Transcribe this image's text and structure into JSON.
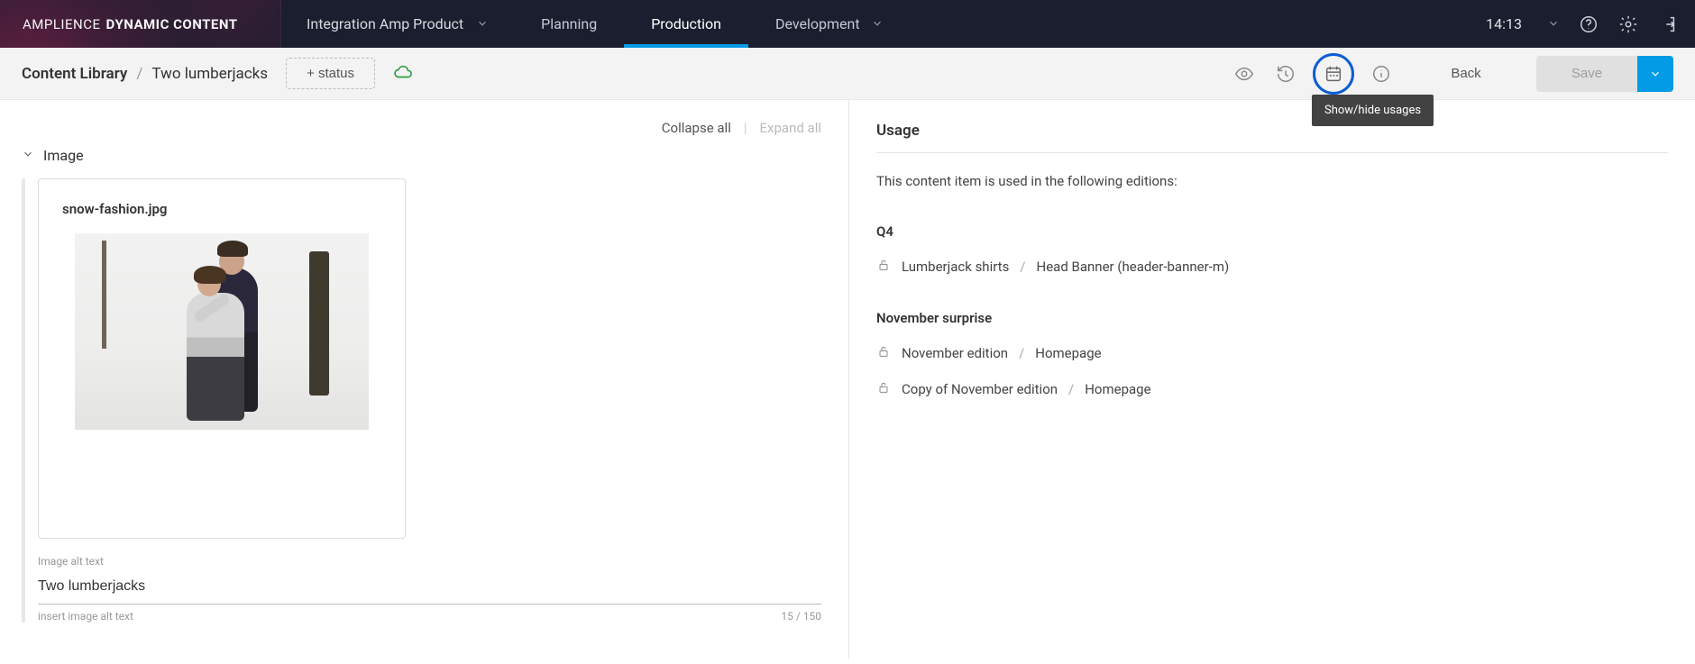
{
  "brand": {
    "w1": "AMPLIENCE",
    "w2": "DYNAMIC CONTENT"
  },
  "hub_dropdown": "Integration Amp Product",
  "tabs": {
    "planning": "Planning",
    "production": "Production",
    "development": "Development"
  },
  "clock": "14:13",
  "subheader": {
    "bc_root": "Content Library",
    "bc_item": "Two lumberjacks",
    "status_chip": "+ status",
    "tooltip": "Show/hide usages",
    "back": "Back",
    "save": "Save"
  },
  "left": {
    "collapse": "Collapse all",
    "expand": "Expand all",
    "section": "Image",
    "filename": "snow-fashion.jpg",
    "alt_label": "Image alt text",
    "alt_value": "Two lumberjacks",
    "alt_placeholder": "insert image alt text",
    "char_count": "15 / 150"
  },
  "usage": {
    "heading": "Usage",
    "description": "This content item is used in the following editions:",
    "groups": [
      {
        "name": "Q4",
        "editions": [
          {
            "edition": "Lumberjack shirts",
            "slot": "Head Banner (header-banner-m)"
          }
        ]
      },
      {
        "name": "November surprise",
        "editions": [
          {
            "edition": "November edition",
            "slot": "Homepage"
          },
          {
            "edition": "Copy of November edition",
            "slot": "Homepage"
          }
        ]
      }
    ]
  }
}
